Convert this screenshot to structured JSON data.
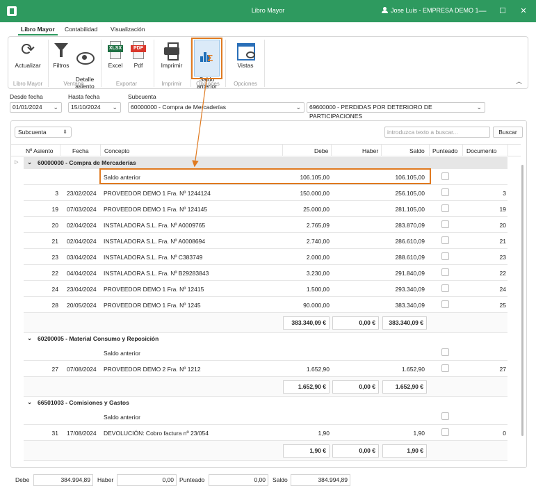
{
  "window": {
    "title": "Libro Mayor",
    "user": "Jose Luis - EMPRESA DEMO 1",
    "minimize": "—",
    "maximize": "☐",
    "close": "✕"
  },
  "ribbon_tabs": [
    "Libro Mayor",
    "Contabilidad",
    "Visualización"
  ],
  "ribbon": {
    "buttons": {
      "actualizar": "Actualizar",
      "filtros": "Filtros",
      "detalle": "Detalle\nasiento",
      "excel": "Excel",
      "excel_badge": "XLSX",
      "pdf": "Pdf",
      "pdf_badge": "PDF",
      "imprimir": "Imprimir",
      "saldo": "Saldo\nanterior",
      "vistas": "Vistas"
    },
    "groups": [
      "Libro Mayor",
      "Ventana",
      "Exportar",
      "Imprimir",
      "Opciones",
      "Opciones"
    ],
    "collapse_icon": "︿"
  },
  "filters": {
    "desde_label": "Desde fecha",
    "desde_value": "01/01/2024",
    "hasta_label": "Hasta fecha",
    "hasta_value": "15/10/2024",
    "subcuenta_label": "Subcuenta",
    "subcuenta_from": "60000000 - Compra de Mercaderías",
    "subcuenta_to": "69600000 - PERDIDAS POR DETERIORO DE PARTICIPACIONES"
  },
  "grid": {
    "group_by": "Subcuenta",
    "search_placeholder": "introduzca texto a buscar...",
    "search_button": "Buscar",
    "headers": [
      "Nº Asiento",
      "Fecha",
      "Concepto",
      "Debe",
      "Haber",
      "Saldo",
      "Punteado",
      "Documento"
    ],
    "groups": [
      {
        "title": "60000000 - Compra de Mercaderías",
        "rows": [
          {
            "asiento": "",
            "fecha": "",
            "concepto": "Saldo anterior",
            "debe": "106.105,00",
            "haber": "",
            "saldo": "106.105,00",
            "documento": ""
          },
          {
            "asiento": "3",
            "fecha": "23/02/2024",
            "concepto": "PROVEEDOR DEMO 1 Fra. Nº 1244124",
            "debe": "150.000,00",
            "haber": "",
            "saldo": "256.105,00",
            "documento": "3"
          },
          {
            "asiento": "19",
            "fecha": "07/03/2024",
            "concepto": "PROVEEDOR DEMO 1 Fra. Nº 124145",
            "debe": "25.000,00",
            "haber": "",
            "saldo": "281.105,00",
            "documento": "19"
          },
          {
            "asiento": "20",
            "fecha": "02/04/2024",
            "concepto": "INSTALADORA S.L. Fra. Nº A0009765",
            "debe": "2.765,09",
            "haber": "",
            "saldo": "283.870,09",
            "documento": "20"
          },
          {
            "asiento": "21",
            "fecha": "02/04/2024",
            "concepto": "INSTALADORA S.L. Fra. Nº A0008694",
            "debe": "2.740,00",
            "haber": "",
            "saldo": "286.610,09",
            "documento": "21"
          },
          {
            "asiento": "23",
            "fecha": "03/04/2024",
            "concepto": "INSTALADORA S.L. Fra. Nº C383749",
            "debe": "2.000,00",
            "haber": "",
            "saldo": "288.610,09",
            "documento": "23"
          },
          {
            "asiento": "22",
            "fecha": "04/04/2024",
            "concepto": "INSTALADORA S.L. Fra. Nº B29283843",
            "debe": "3.230,00",
            "haber": "",
            "saldo": "291.840,09",
            "documento": "22"
          },
          {
            "asiento": "24",
            "fecha": "23/04/2024",
            "concepto": "PROVEEDOR DEMO 1 Fra. Nº 12415",
            "debe": "1.500,00",
            "haber": "",
            "saldo": "293.340,09",
            "documento": "24"
          },
          {
            "asiento": "28",
            "fecha": "20/05/2024",
            "concepto": "PROVEEDOR DEMO 1 Fra. Nº 1245",
            "debe": "90.000,00",
            "haber": "",
            "saldo": "383.340,09",
            "documento": "25"
          }
        ],
        "totals": {
          "debe": "383.340,09 €",
          "haber": "0,00 €",
          "saldo": "383.340,09 €"
        }
      },
      {
        "title": "60200005 - Material Consumo y Reposición",
        "rows": [
          {
            "asiento": "",
            "fecha": "",
            "concepto": "Saldo anterior",
            "debe": "",
            "haber": "",
            "saldo": "",
            "documento": ""
          },
          {
            "asiento": "27",
            "fecha": "07/08/2024",
            "concepto": "PROVEEDOR DEMO 2 Fra. Nº 1212",
            "debe": "1.652,90",
            "haber": "",
            "saldo": "1.652,90",
            "documento": "27"
          }
        ],
        "totals": {
          "debe": "1.652,90 €",
          "haber": "0,00 €",
          "saldo": "1.652,90 €"
        }
      },
      {
        "title": "66501003 - Comisiones y Gastos",
        "rows": [
          {
            "asiento": "",
            "fecha": "",
            "concepto": "Saldo anterior",
            "debe": "",
            "haber": "",
            "saldo": "",
            "documento": ""
          },
          {
            "asiento": "31",
            "fecha": "17/08/2024",
            "concepto": "DEVOLUCIÓN: Cobro factura nº 23/054",
            "debe": "1,90",
            "haber": "",
            "saldo": "1,90",
            "documento": "0"
          }
        ],
        "totals": {
          "debe": "1,90 €",
          "haber": "0,00 €",
          "saldo": "1,90 €"
        }
      }
    ]
  },
  "footer": {
    "debe_label": "Debe",
    "debe_value": "384.994,89",
    "haber_label": "Haber",
    "haber_value": "0,00",
    "punteado_label": "Punteado",
    "punteado_value": "0,00",
    "saldo_label": "Saldo",
    "saldo_value": "384.994,89"
  },
  "colors": {
    "titlebar": "#2e9a5f",
    "highlight": "#e07a20",
    "group_row": "#e6e6e6"
  }
}
